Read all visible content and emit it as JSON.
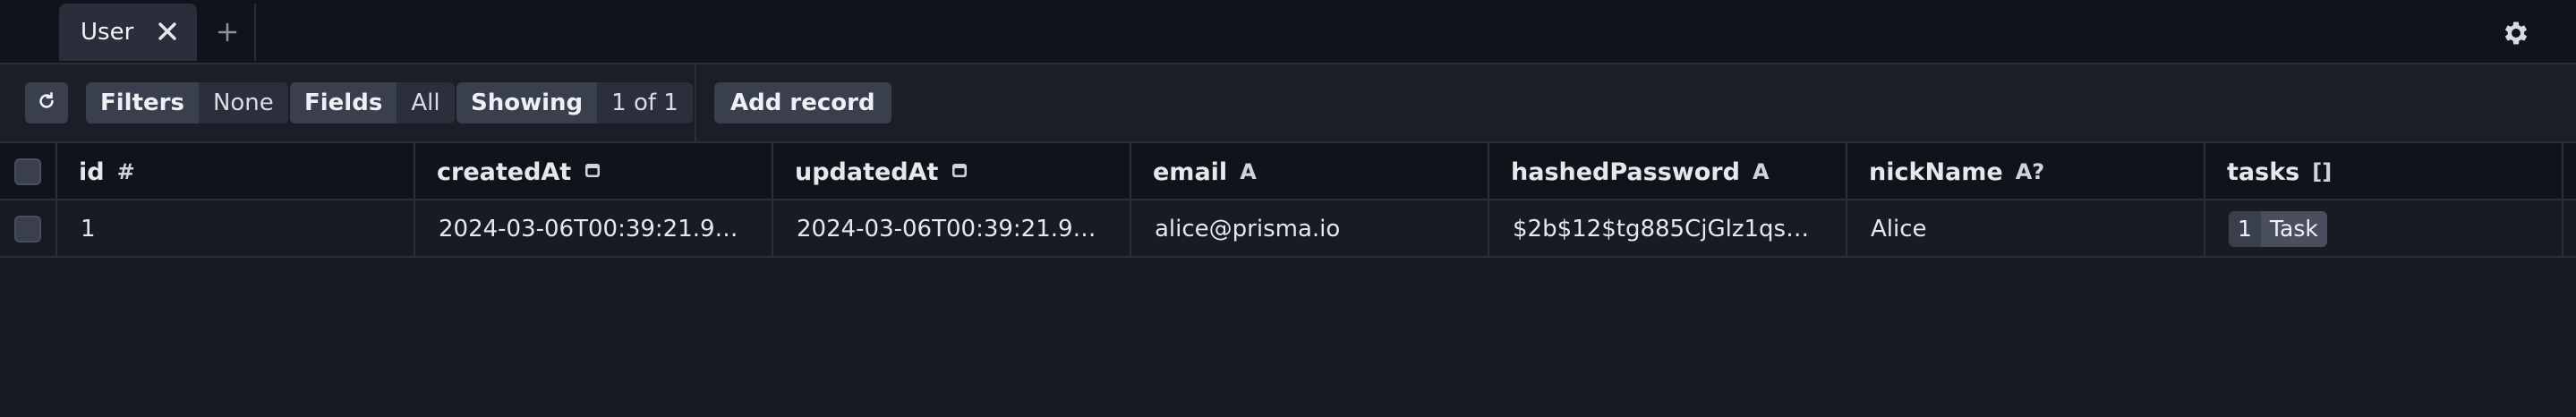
{
  "tabs": [
    {
      "label": "User"
    }
  ],
  "toolbar": {
    "filters": {
      "label": "Filters",
      "value": "None"
    },
    "fields": {
      "label": "Fields",
      "value": "All"
    },
    "showing": {
      "label": "Showing",
      "value": "1 of 1"
    },
    "add_record_label": "Add record"
  },
  "columns": [
    {
      "name": "id",
      "type_glyph": "#"
    },
    {
      "name": "createdAt",
      "type_glyph": "calendar-icon"
    },
    {
      "name": "updatedAt",
      "type_glyph": "calendar-icon"
    },
    {
      "name": "email",
      "type_glyph": "A"
    },
    {
      "name": "hashedPassword",
      "type_glyph": "A"
    },
    {
      "name": "nickName",
      "type_glyph": "A?"
    },
    {
      "name": "tasks",
      "type_glyph": "[]"
    }
  ],
  "rows": [
    {
      "id": "1",
      "createdAt": "2024-03-06T00:39:21.9…",
      "updatedAt": "2024-03-06T00:39:21.9…",
      "email": "alice@prisma.io",
      "hashedPassword": "$2b$12$tg885CjGlz1qs…",
      "nickName": "Alice",
      "tasks": {
        "count": "1",
        "label": "Task"
      }
    }
  ],
  "icons": {
    "tab_close": "close-icon",
    "new_tab": "plus-icon",
    "settings": "gear-icon",
    "refresh": "refresh-icon"
  },
  "colors": {
    "background": "#181b24",
    "tabbar": "#11131a",
    "button": "#3a3f4d",
    "border": "#2b2f3b"
  }
}
